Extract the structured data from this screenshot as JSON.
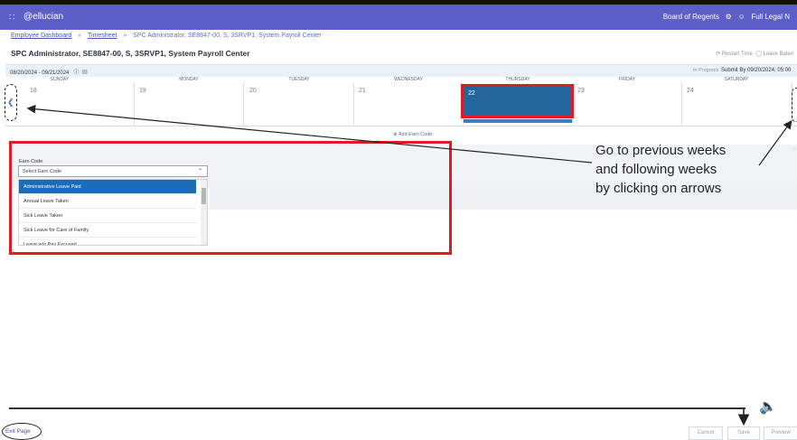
{
  "topbar": {
    "grid_icon": "grid-icon",
    "logo_text": "@ellucian",
    "right_text": "Board of Regents",
    "gear_icon": "gear-icon",
    "user_icon": "user-icon",
    "user_label": "Full Legal N"
  },
  "breadcrumb": {
    "items": [
      "Employee Dashboard",
      "Timesheet"
    ],
    "current": "SPC Administrator, SE8847-00, S, 3SRVP1, System Payroll Center"
  },
  "page": {
    "title": "SPC Administrator, SE8847-00, S, 3SRVP1, System Payroll Center",
    "restart_time": "Restart Time",
    "leave_balances": "Leave Balan"
  },
  "period": {
    "range": "08/20/2024 - 09/21/2024",
    "status": "In Progress",
    "submit_by": "Submit By 09/20/2024, 05:00"
  },
  "calendar": {
    "days": [
      {
        "name": "SUNDAY",
        "date": "18"
      },
      {
        "name": "MONDAY",
        "date": "19"
      },
      {
        "name": "TUESDAY",
        "date": "20"
      },
      {
        "name": "WEDNESDAY",
        "date": "21"
      },
      {
        "name": "THURSDAY",
        "date": "22"
      },
      {
        "name": "FRIDAY",
        "date": "23"
      },
      {
        "name": "SATURDAY",
        "date": "24"
      }
    ],
    "selected_index": 4,
    "add_earn_code": "Add Earn Code"
  },
  "earn_code": {
    "label": "Earn Code",
    "placeholder": "Select Earn Code",
    "options": [
      "Administrative Leave Paid",
      "Annual Leave Taken",
      "Sick Leave Taken",
      "Sick Leave for Care of Family",
      "Leave w/o Pay Excused"
    ],
    "selected_option": "Administrative Leave Paid"
  },
  "annotation": {
    "line1": "Go to previous weeks",
    "line2": "and following weeks",
    "line3": "by clicking on arrows"
  },
  "footer": {
    "exit": "Exit Page",
    "cancel": "Cancel",
    "save": "Save",
    "preview": "Preview"
  },
  "colors": {
    "topbar": "#5b5fc7",
    "selected_day": "#23669b",
    "highlight_red": "#e11b22",
    "selected_option": "#1a6bb8"
  }
}
